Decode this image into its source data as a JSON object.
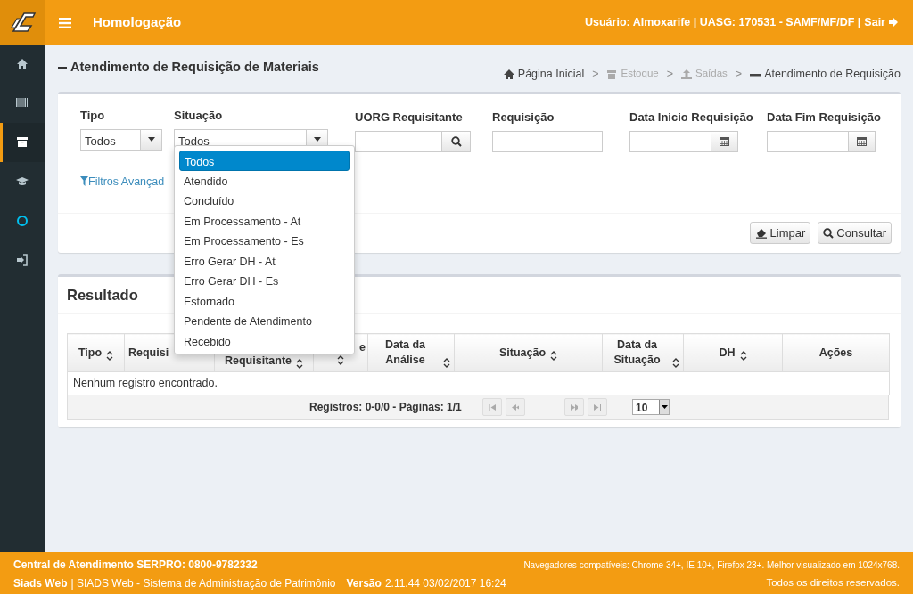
{
  "header": {
    "title": "Homologação",
    "user_info": "Usuário: Almoxarife | UASG: 170531 - SAMF/MF/DF |",
    "logout": "Sair"
  },
  "sidebar": {
    "items": [
      {
        "kind": "home",
        "selected": false
      },
      {
        "kind": "barcode",
        "selected": false
      },
      {
        "kind": "archive",
        "selected": true
      },
      {
        "kind": "cap",
        "selected": false
      },
      {
        "kind": "circle",
        "selected": false
      },
      {
        "kind": "signin",
        "selected": false
      }
    ]
  },
  "page_title": "Atendimento de Requisição de Materiais",
  "breadcrumb": [
    {
      "kind": "home",
      "label": "Página Inicial",
      "disabled": false
    },
    {
      "kind": "archive",
      "label": "Estoque",
      "disabled": true
    },
    {
      "kind": "upload",
      "label": "Saídas",
      "disabled": true
    },
    {
      "kind": "minus",
      "label": "Atendimento de Requisição",
      "disabled": false
    }
  ],
  "breadcrumb_separators": [
    ">",
    ">",
    ">"
  ],
  "filters": [
    {
      "kind": "select",
      "label": "Tipo",
      "value": "Todos"
    },
    {
      "kind": "select",
      "label": "Situação",
      "value": "Todos"
    },
    {
      "kind": "search",
      "label": "UORG Requisitante"
    },
    {
      "kind": "text",
      "label": "Requisição"
    },
    {
      "kind": "date",
      "label": "Data Inicio Requisição"
    },
    {
      "kind": "date",
      "label": "Data Fim Requisição"
    }
  ],
  "advanced_filters": "Filtros Avançad",
  "buttons": [
    {
      "kind": "eraser",
      "label": "Limpar"
    },
    {
      "kind": "search",
      "label": "Consultar"
    }
  ],
  "dropdown": {
    "options": [
      {
        "label": "Todos",
        "selected": true
      },
      {
        "label": "Atendido",
        "selected": false
      },
      {
        "label": "Concluído",
        "selected": false
      },
      {
        "label": "Em Processamento - At",
        "selected": false
      },
      {
        "label": "Em Processamento - Es",
        "selected": false
      },
      {
        "label": "Erro Gerar DH - At",
        "selected": false
      },
      {
        "label": "Erro Gerar DH - Es",
        "selected": false
      },
      {
        "label": "Estornado",
        "selected": false
      },
      {
        "label": "Pendente de Atendimento",
        "selected": false
      },
      {
        "label": "Recebido",
        "selected": false
      }
    ]
  },
  "result": {
    "title": "Resultado",
    "columns": [
      {
        "label": "Tipo",
        "sortable": true
      },
      {
        "label": "Requisi",
        "sortable": false
      },
      {
        "label": "Requisitante",
        "sortable": true
      },
      {
        "label": "e",
        "sortable": true
      },
      {
        "label": "Data da Análise",
        "sortable": true
      },
      {
        "label": "Situação",
        "sortable": true
      },
      {
        "label": "Data da Situação",
        "sortable": true
      },
      {
        "label": "DH",
        "sortable": true
      },
      {
        "label": "Ações",
        "sortable": false
      }
    ],
    "empty_message": "Nenhum registro encontrado.",
    "pager_info": "Registros: 0-0/0 - Páginas: 1/1",
    "page_size": "10"
  },
  "footer": {
    "support": "Central de Atendimento SERPRO: 0800-9782332",
    "browsers": "Navegadores compatíveis: Chrome 34+, IE 10+, Firefox 23+. Melhor visualizado em 1024x768.",
    "app_name": "Siads Web",
    "app_desc": "| SIADS Web - Sistema de Administração de Patrimônio",
    "version_label": "Versão",
    "version": "2.11.44 03/02/2017 16:24",
    "rights": "Todos os direitos reservados."
  }
}
